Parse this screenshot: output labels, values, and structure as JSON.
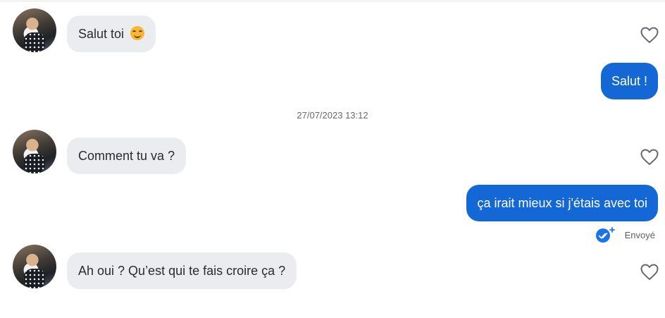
{
  "conversation": {
    "timestamp": "27/07/2023 13:12",
    "messages": [
      {
        "direction": "in",
        "text": "Salut toi",
        "emoji": "smiling-face-emoji"
      },
      {
        "direction": "out",
        "text": "Salut !"
      },
      {
        "direction": "in",
        "text": "Comment tu va ?"
      },
      {
        "direction": "out",
        "text": "ça irait mieux si j'étais avec toi",
        "status": "Envoyé"
      },
      {
        "direction": "in",
        "text": "Ah oui ? Qu’est qui te fais croire ça ?"
      }
    ]
  },
  "colors": {
    "incoming_bubble": "#ebecf0",
    "outgoing_bubble": "#1468d6",
    "read_check": "#1a73e8"
  },
  "icons": {
    "like": "heart-outline-icon",
    "read_status": "double-check-icon"
  }
}
